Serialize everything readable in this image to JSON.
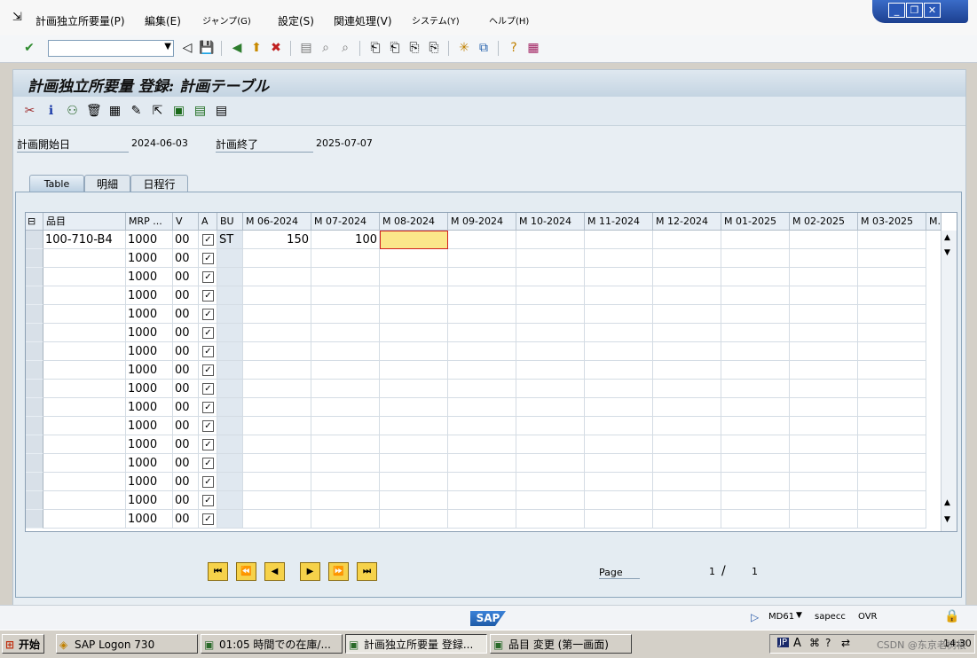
{
  "menu": {
    "items": [
      "計画独立所要量(P)",
      "編集(E)",
      "ジャンプ(G)",
      "設定(S)",
      "関連処理(V)",
      "システム(Y)",
      "ヘルプ(H)"
    ]
  },
  "window_controls": {
    "minimize": "_",
    "restore": "❐",
    "close": "✕"
  },
  "toolbar": {
    "command_field_value": ""
  },
  "page": {
    "title": "計画独立所要量 登録:  計画テーブル"
  },
  "header_fields": {
    "start_label": "計画開始日",
    "start_value": "2024-06-03",
    "end_label": "計画終了",
    "end_value": "2025-07-07"
  },
  "tabs": [
    {
      "label": "Table",
      "active": true
    },
    {
      "label": "明細",
      "active": false
    },
    {
      "label": "日程行",
      "active": false
    }
  ],
  "table": {
    "columns": [
      "品目",
      "MRP ...",
      "V",
      "A",
      "BU",
      "M 06-2024",
      "M 07-2024",
      "M 08-2024",
      "M 09-2024",
      "M 10-2024",
      "M 11-2024",
      "M 12-2024",
      "M 01-2025",
      "M 02-2025",
      "M 03-2025",
      "M."
    ],
    "rows": [
      {
        "material": "100-710-B4",
        "mrp": "1000",
        "v": "00",
        "a": true,
        "bu": "ST",
        "m1": "150",
        "m2": "100"
      },
      {
        "material": "",
        "mrp": "1000",
        "v": "00",
        "a": true,
        "bu": "",
        "m1": "",
        "m2": ""
      },
      {
        "material": "",
        "mrp": "1000",
        "v": "00",
        "a": true,
        "bu": "",
        "m1": "",
        "m2": ""
      },
      {
        "material": "",
        "mrp": "1000",
        "v": "00",
        "a": true,
        "bu": "",
        "m1": "",
        "m2": ""
      },
      {
        "material": "",
        "mrp": "1000",
        "v": "00",
        "a": true,
        "bu": "",
        "m1": "",
        "m2": ""
      },
      {
        "material": "",
        "mrp": "1000",
        "v": "00",
        "a": true,
        "bu": "",
        "m1": "",
        "m2": ""
      },
      {
        "material": "",
        "mrp": "1000",
        "v": "00",
        "a": true,
        "bu": "",
        "m1": "",
        "m2": ""
      },
      {
        "material": "",
        "mrp": "1000",
        "v": "00",
        "a": true,
        "bu": "",
        "m1": "",
        "m2": ""
      },
      {
        "material": "",
        "mrp": "1000",
        "v": "00",
        "a": true,
        "bu": "",
        "m1": "",
        "m2": ""
      },
      {
        "material": "",
        "mrp": "1000",
        "v": "00",
        "a": true,
        "bu": "",
        "m1": "",
        "m2": ""
      },
      {
        "material": "",
        "mrp": "1000",
        "v": "00",
        "a": true,
        "bu": "",
        "m1": "",
        "m2": ""
      },
      {
        "material": "",
        "mrp": "1000",
        "v": "00",
        "a": true,
        "bu": "",
        "m1": "",
        "m2": ""
      },
      {
        "material": "",
        "mrp": "1000",
        "v": "00",
        "a": true,
        "bu": "",
        "m1": "",
        "m2": ""
      },
      {
        "material": "",
        "mrp": "1000",
        "v": "00",
        "a": true,
        "bu": "",
        "m1": "",
        "m2": ""
      },
      {
        "material": "",
        "mrp": "1000",
        "v": "00",
        "a": true,
        "bu": "",
        "m1": "",
        "m2": ""
      },
      {
        "material": "",
        "mrp": "1000",
        "v": "00",
        "a": true,
        "bu": "",
        "m1": "",
        "m2": ""
      }
    ]
  },
  "pagination": {
    "label": "Page",
    "current": "1",
    "separator": "/",
    "total": "1"
  },
  "status": {
    "transaction": "MD61",
    "server": "sapecc",
    "mode": "OVR",
    "logo": "SAP"
  },
  "taskbar": {
    "start_label": "开始",
    "tasks": [
      "SAP Logon 730",
      "01:05 時間での在庫/...",
      "計画独立所要量 登録...",
      "品目 変更 (第一画面)"
    ],
    "ime": "JP",
    "time": "14:30",
    "watermark": "CSDN @东京老树根"
  },
  "colors": {
    "accent": "#f6d24a",
    "title_bg": "#c4d4e2",
    "focus_cell": "#fbe78a"
  }
}
